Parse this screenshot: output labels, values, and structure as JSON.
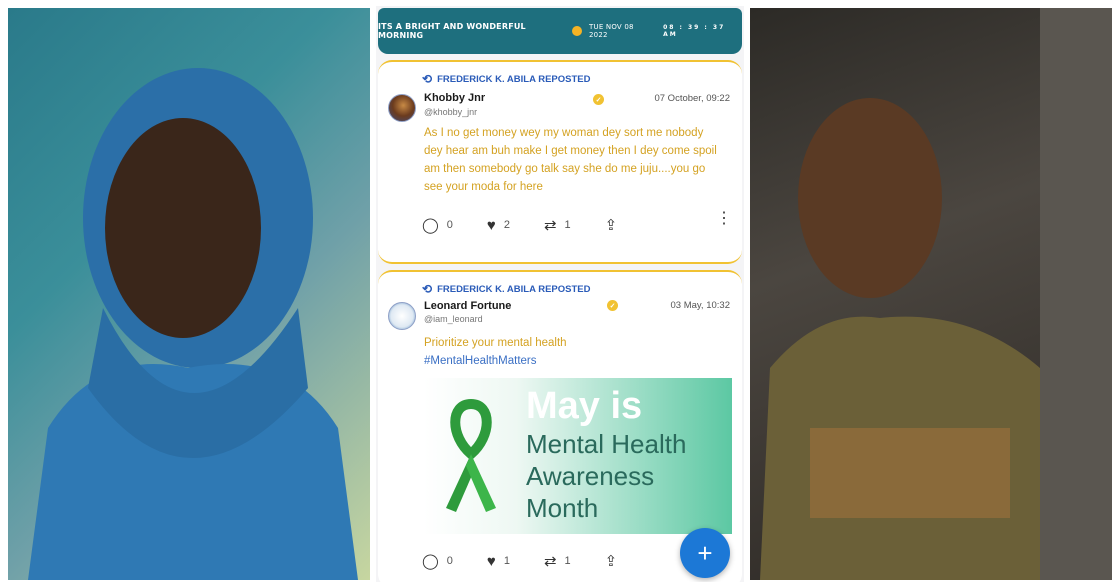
{
  "banner": {
    "text": "ITS A BRIGHT AND WONDERFUL MORNING",
    "date": "TUE NOV 08 2022",
    "clock": "08 : 39 : 37 AM"
  },
  "posts": [
    {
      "repost_label": "FREDERICK K. ABILA REPOSTED",
      "author": "Khobby Jnr",
      "handle": "@khobby_jnr",
      "timestamp": "07 October, 09:22",
      "text": "As I no get money wey my woman dey sort me nobody dey hear am buh make I get money then I dey come spoil am then somebody go talk say she do me juju....you go see your moda for here",
      "replies": "0",
      "likes": "2",
      "reposts": "1"
    },
    {
      "repost_label": "FREDERICK K. ABILA REPOSTED",
      "author": "Leonard Fortune",
      "handle": "@iam_leonard",
      "timestamp": "03 May, 10:32",
      "text": "Prioritize your mental health",
      "hashtag": "#MentalHealthMatters",
      "image": {
        "headline": "May is",
        "line1": "Mental Health",
        "line2": "Awareness",
        "line3": "Month"
      },
      "replies": "0",
      "likes": "1",
      "reposts": "1"
    }
  ],
  "fab_label": "+",
  "colors": {
    "banner": "#1e6f7e",
    "accent_border": "#f1c232",
    "repost_blue": "#2a5bb8",
    "post_text": "#d4a222",
    "fab": "#1c78d6"
  },
  "icons": [
    "repost-icon",
    "verified-icon",
    "reply-icon",
    "heart-icon",
    "retweet-icon",
    "share-icon",
    "more-icon",
    "awareness-ribbon-icon",
    "add-icon"
  ]
}
